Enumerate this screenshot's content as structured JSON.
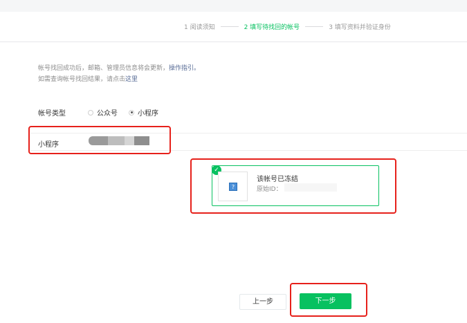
{
  "steps": [
    {
      "label": "1 阅读须知",
      "active": false
    },
    {
      "label": "2 填写待找回的帐号",
      "active": true
    },
    {
      "label": "3 填写资料并验证身份",
      "active": false
    }
  ],
  "notice": {
    "line1_text": "帐号找回成功后，邮箱、管理员信息将会更新，",
    "line1_link": "操作指引。",
    "line2_text": "如需查询帐号找回结果，请点击",
    "line2_link": "这里"
  },
  "account_type": {
    "label": "帐号类型",
    "options": [
      {
        "label": "公众号",
        "checked": false
      },
      {
        "label": "小程序",
        "checked": true
      }
    ]
  },
  "mini_program": {
    "label": "小程序"
  },
  "account_card": {
    "title": "该帐号已冻结",
    "original_id_label": "原始ID："
  },
  "buttons": {
    "prev": "上一步",
    "next": "下一步"
  },
  "colors": {
    "accent": "#07c160",
    "highlight": "#e6201a",
    "link": "#576b95"
  }
}
